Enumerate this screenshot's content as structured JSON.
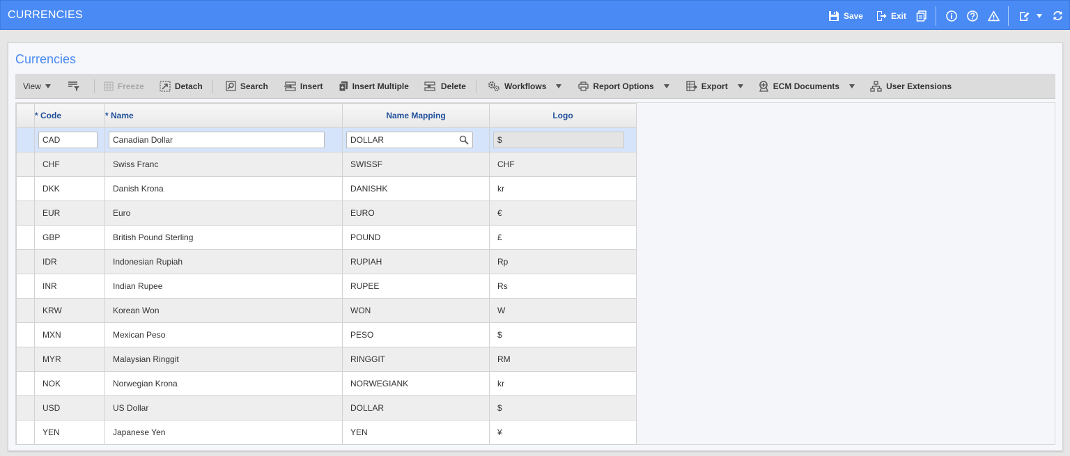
{
  "header": {
    "title": "CURRENCIES",
    "save_label": "Save",
    "exit_label": "Exit"
  },
  "panel": {
    "title": "Currencies"
  },
  "toolbar": {
    "view_label": "View",
    "freeze_label": "Freeze",
    "detach_label": "Detach",
    "search_label": "Search",
    "insert_label": "Insert",
    "insert_multiple_label": "Insert Multiple",
    "delete_label": "Delete",
    "workflows_label": "Workflows",
    "report_options_label": "Report Options",
    "export_label": "Export",
    "ecm_documents_label": "ECM Documents",
    "user_extensions_label": "User Extensions"
  },
  "grid": {
    "columns": {
      "code": "* Code",
      "name": "* Name",
      "name_mapping": "Name Mapping",
      "logo": "Logo"
    },
    "active_row": {
      "code": "CAD",
      "name": "Canadian Dollar",
      "name_mapping": "DOLLAR",
      "logo": "$"
    },
    "rows": [
      {
        "code": "CHF",
        "name": "Swiss Franc",
        "name_mapping": "SWISSF",
        "logo": "CHF"
      },
      {
        "code": "DKK",
        "name": "Danish Krona",
        "name_mapping": "DANISHK",
        "logo": "kr"
      },
      {
        "code": "EUR",
        "name": "Euro",
        "name_mapping": "EURO",
        "logo": "€"
      },
      {
        "code": "GBP",
        "name": "British Pound Sterling",
        "name_mapping": "POUND",
        "logo": "£"
      },
      {
        "code": "IDR",
        "name": "Indonesian Rupiah",
        "name_mapping": "RUPIAH",
        "logo": "Rp"
      },
      {
        "code": "INR",
        "name": "Indian Rupee",
        "name_mapping": "RUPEE",
        "logo": "Rs"
      },
      {
        "code": "KRW",
        "name": "Korean Won",
        "name_mapping": "WON",
        "logo": "W"
      },
      {
        "code": "MXN",
        "name": "Mexican Peso",
        "name_mapping": "PESO",
        "logo": "$"
      },
      {
        "code": "MYR",
        "name": "Malaysian Ringgit",
        "name_mapping": "RINGGIT",
        "logo": "RM"
      },
      {
        "code": "NOK",
        "name": "Norwegian Krona",
        "name_mapping": "NORWEGIANK",
        "logo": "kr"
      },
      {
        "code": "USD",
        "name": "US Dollar",
        "name_mapping": "DOLLAR",
        "logo": "$"
      },
      {
        "code": "YEN",
        "name": "Japanese Yen",
        "name_mapping": "YEN",
        "logo": "¥"
      }
    ]
  },
  "icons": {
    "save": "save-icon",
    "exit": "exit-icon",
    "copy": "copy-icon",
    "info": "info-icon",
    "help": "help-icon",
    "warning": "warning-icon",
    "edit": "edit-icon",
    "refresh": "refresh-icon"
  },
  "colors": {
    "header_bg": "#4a8af4",
    "panel_title": "#4a8af4",
    "column_header_text": "#1f4f9a",
    "active_row_bg": "#d5e4fa"
  }
}
